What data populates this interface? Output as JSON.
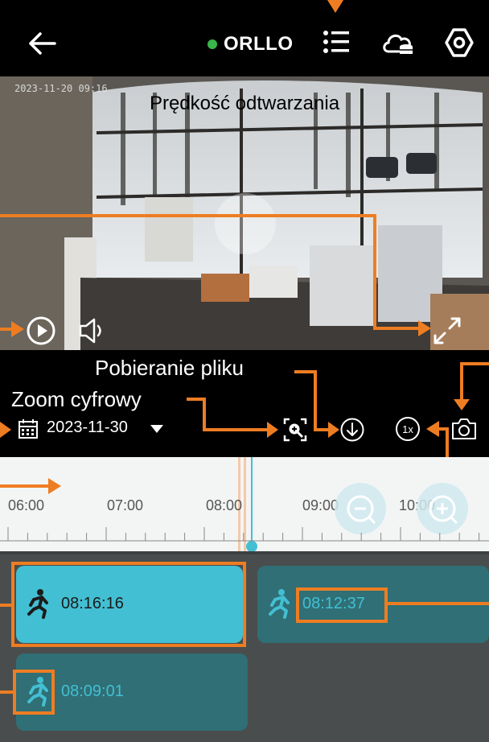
{
  "header": {
    "brand": "ORLLO",
    "status_color": "#39b54a",
    "icons": [
      "back-arrow-icon",
      "list-icon",
      "cloud-storage-icon",
      "settings-hex-icon"
    ]
  },
  "video": {
    "timestamp": "2023-11-20 09:16",
    "speed_label": "Prędkość odtwarzania"
  },
  "controls": {
    "download_label": "Pobieranie pliku",
    "zoom_label": "Zoom cyfrowy",
    "date": "2023-11-30",
    "speed_button": "1x"
  },
  "timeline": {
    "ticks": [
      "06:00",
      "07:00",
      "08:00",
      "09:00",
      "10:00"
    ]
  },
  "events": [
    {
      "time": "08:16:16",
      "selected": true
    },
    {
      "time": "08:12:37",
      "selected": false
    },
    {
      "time": "08:09:01",
      "selected": false
    }
  ],
  "colors": {
    "accent_orange": "#ee7d22",
    "accent_cyan": "#43bfd3",
    "card_dark": "#2f6f75"
  }
}
